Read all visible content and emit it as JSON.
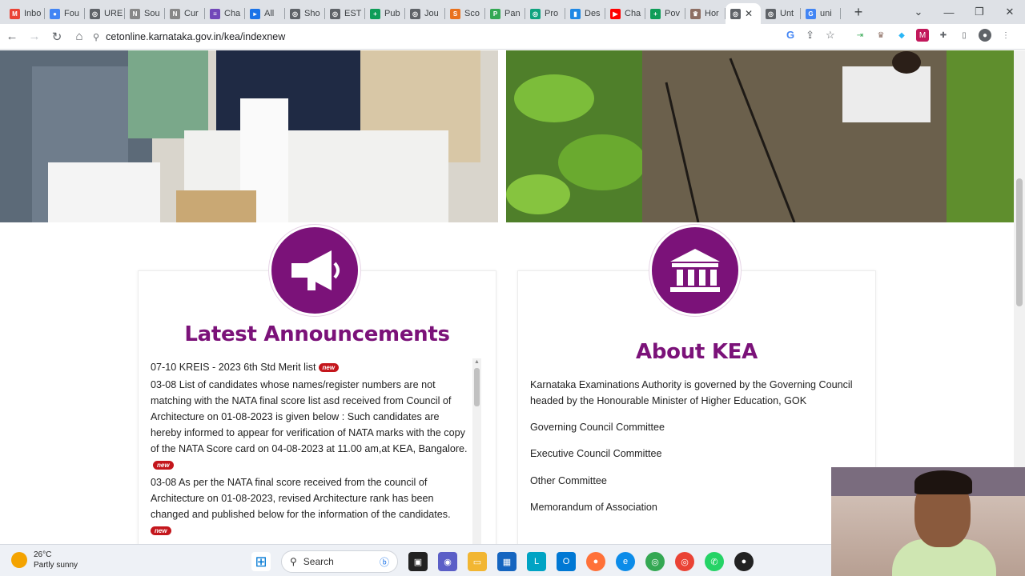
{
  "browser": {
    "tabs": [
      {
        "label": "Inbo",
        "icon": "gmail-icon",
        "color": "#ea4335",
        "glyph": "M"
      },
      {
        "label": "Fou",
        "icon": "google-docs-icon",
        "color": "#4285f4",
        "glyph": "●"
      },
      {
        "label": "URE",
        "icon": "globe-icon",
        "color": "#5f6368",
        "glyph": "◎"
      },
      {
        "label": "Sou",
        "icon": "nmn-icon",
        "color": "#888",
        "glyph": "N"
      },
      {
        "label": "Cur",
        "icon": "nmn-icon",
        "color": "#888",
        "glyph": "N"
      },
      {
        "label": "Cha",
        "icon": "forms-icon",
        "color": "#7248b9",
        "glyph": "≡"
      },
      {
        "label": "All",
        "icon": "play-icon",
        "color": "#1a73e8",
        "glyph": "▸"
      },
      {
        "label": "Sho",
        "icon": "globe-icon",
        "color": "#5f6368",
        "glyph": "◎"
      },
      {
        "label": "EST",
        "icon": "globe-icon",
        "color": "#5f6368",
        "glyph": "◎"
      },
      {
        "label": "Pub",
        "icon": "sheets-icon",
        "color": "#0f9d58",
        "glyph": "+"
      },
      {
        "label": "Jou",
        "icon": "globe-icon",
        "color": "#5f6368",
        "glyph": "◎"
      },
      {
        "label": "Sco",
        "icon": "scopus-icon",
        "color": "#e9711c",
        "glyph": "S"
      },
      {
        "label": "Pan",
        "icon": "leaf-icon",
        "color": "#34a853",
        "glyph": "P"
      },
      {
        "label": "Pro",
        "icon": "chatgpt-icon",
        "color": "#10a37f",
        "glyph": "◎"
      },
      {
        "label": "Des",
        "icon": "bar-chart-icon",
        "color": "#1e88e5",
        "glyph": "▮"
      },
      {
        "label": "Cha",
        "icon": "youtube-icon",
        "color": "#ff0000",
        "glyph": "▶"
      },
      {
        "label": "Pov",
        "icon": "sheets-icon",
        "color": "#0f9d58",
        "glyph": "+"
      },
      {
        "label": "Hor",
        "icon": "emblem-icon",
        "color": "#8d6e63",
        "glyph": "♛"
      },
      {
        "label": "",
        "icon": "globe-icon",
        "color": "#5f6368",
        "glyph": "◎",
        "active": true
      },
      {
        "label": "Unt",
        "icon": "globe-icon",
        "color": "#5f6368",
        "glyph": "◎"
      },
      {
        "label": "uni",
        "icon": "google-icon",
        "color": "#4285f4",
        "glyph": "G"
      }
    ],
    "url": "cetonline.karnataka.gov.in/kea/indexnew"
  },
  "announcements": {
    "title": "Latest Announcements",
    "new_badge": "new",
    "items": [
      "07-10 KREIS - 2023 6th Std Merit list",
      "03-08 List of candidates whose names/register numbers are not matching with the NATA final score list asd received from Council of Architecture on 01-08-2023 is given below : Such candidates are hereby informed to appear for verification of NATA marks with the copy of the NATA Score card on 04-08-2023 at 11.00 am,at KEA, Bangalore.",
      "03-08 As per the NATA final score received from the council of Architecture on 01-08-2023, revised Architecture rank has been changed and published below for the information of the candidates."
    ]
  },
  "about": {
    "title": "About KEA",
    "description": "Karnataka Examinations Authority is governed by the Governing Council headed by the Honourable Minister of Higher Education, GOK",
    "links": [
      "Governing Council Committee",
      "Executive Council Committee",
      "Other Committee",
      "Memorandum of Association"
    ]
  },
  "taskbar": {
    "temperature": "26°C",
    "condition": "Partly sunny",
    "search_label": "Search"
  }
}
